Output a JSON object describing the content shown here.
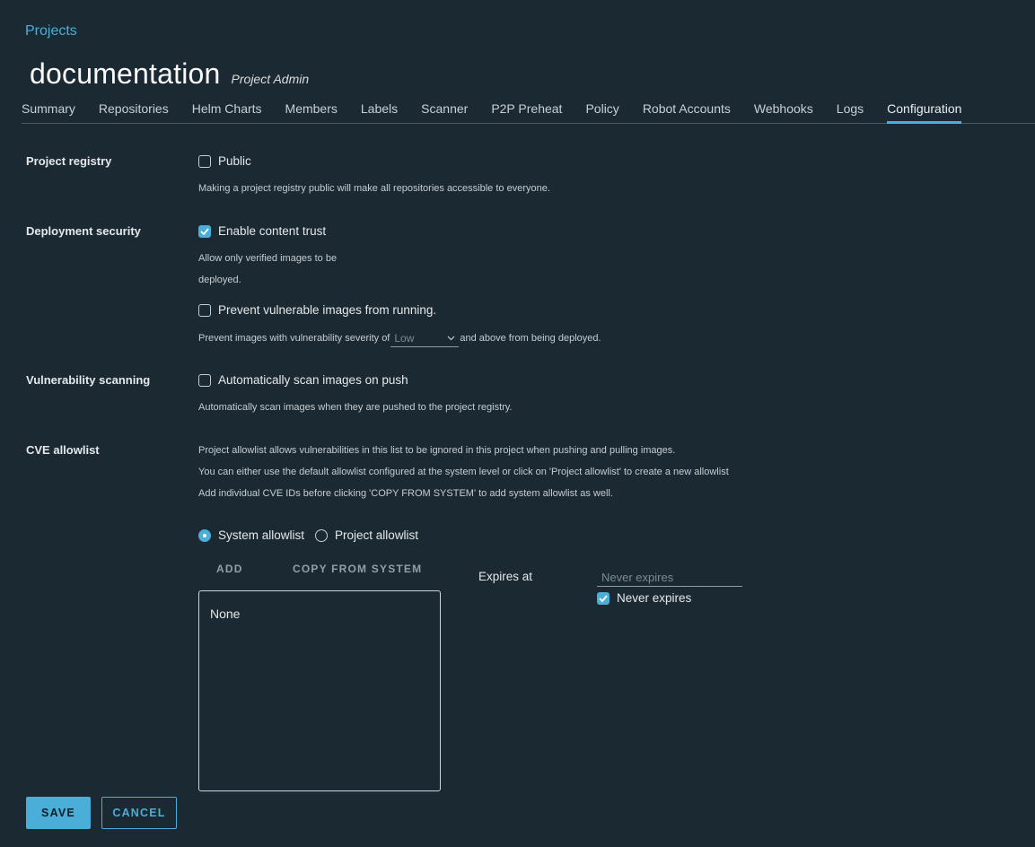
{
  "breadcrumb": "Projects",
  "project": {
    "name": "documentation",
    "role": "Project Admin"
  },
  "tabs": [
    "Summary",
    "Repositories",
    "Helm Charts",
    "Members",
    "Labels",
    "Scanner",
    "P2P Preheat",
    "Policy",
    "Robot Accounts",
    "Webhooks",
    "Logs",
    "Configuration"
  ],
  "active_tab": "Configuration",
  "project_registry": {
    "label": "Project registry",
    "public_label": "Public",
    "public_checked": false,
    "help": "Making a project registry public will make all repositories accessible to everyone."
  },
  "deployment_security": {
    "label": "Deployment security",
    "content_trust_label": "Enable content trust",
    "content_trust_checked": true,
    "content_trust_help_1": "Allow only verified images to be",
    "content_trust_help_2": "deployed.",
    "prevent_label": "Prevent vulnerable images from running.",
    "prevent_checked": false,
    "severity_prefix": "Prevent images with vulnerability severity of",
    "severity_value": "Low",
    "severity_suffix": "and above from being deployed."
  },
  "vulnerability_scanning": {
    "label": "Vulnerability scanning",
    "auto_scan_label": "Automatically scan images on push",
    "auto_scan_checked": false,
    "help": "Automatically scan images when they are pushed to the project registry."
  },
  "cve_allowlist": {
    "label": "CVE allowlist",
    "help_1": "Project allowlist allows vulnerabilities in this list to be ignored in this project when pushing and pulling images.",
    "help_2": "You can either use the default allowlist configured at the system level or click on 'Project allowlist' to create a new allowlist",
    "help_3": "Add individual CVE IDs before clicking 'COPY FROM SYSTEM' to add system allowlist as well.",
    "system_option": "System allowlist",
    "project_option": "Project allowlist",
    "selected": "system",
    "add_label": "ADD",
    "copy_label": "COPY FROM SYSTEM",
    "list_empty_text": "None",
    "expires_label": "Expires at",
    "expires_placeholder": "Never expires",
    "never_expires_label": "Never expires",
    "never_expires_checked": true
  },
  "actions": {
    "save": "SAVE",
    "cancel": "CANCEL"
  },
  "colors": {
    "accent": "#4aaed9",
    "background": "#1b2a32"
  }
}
